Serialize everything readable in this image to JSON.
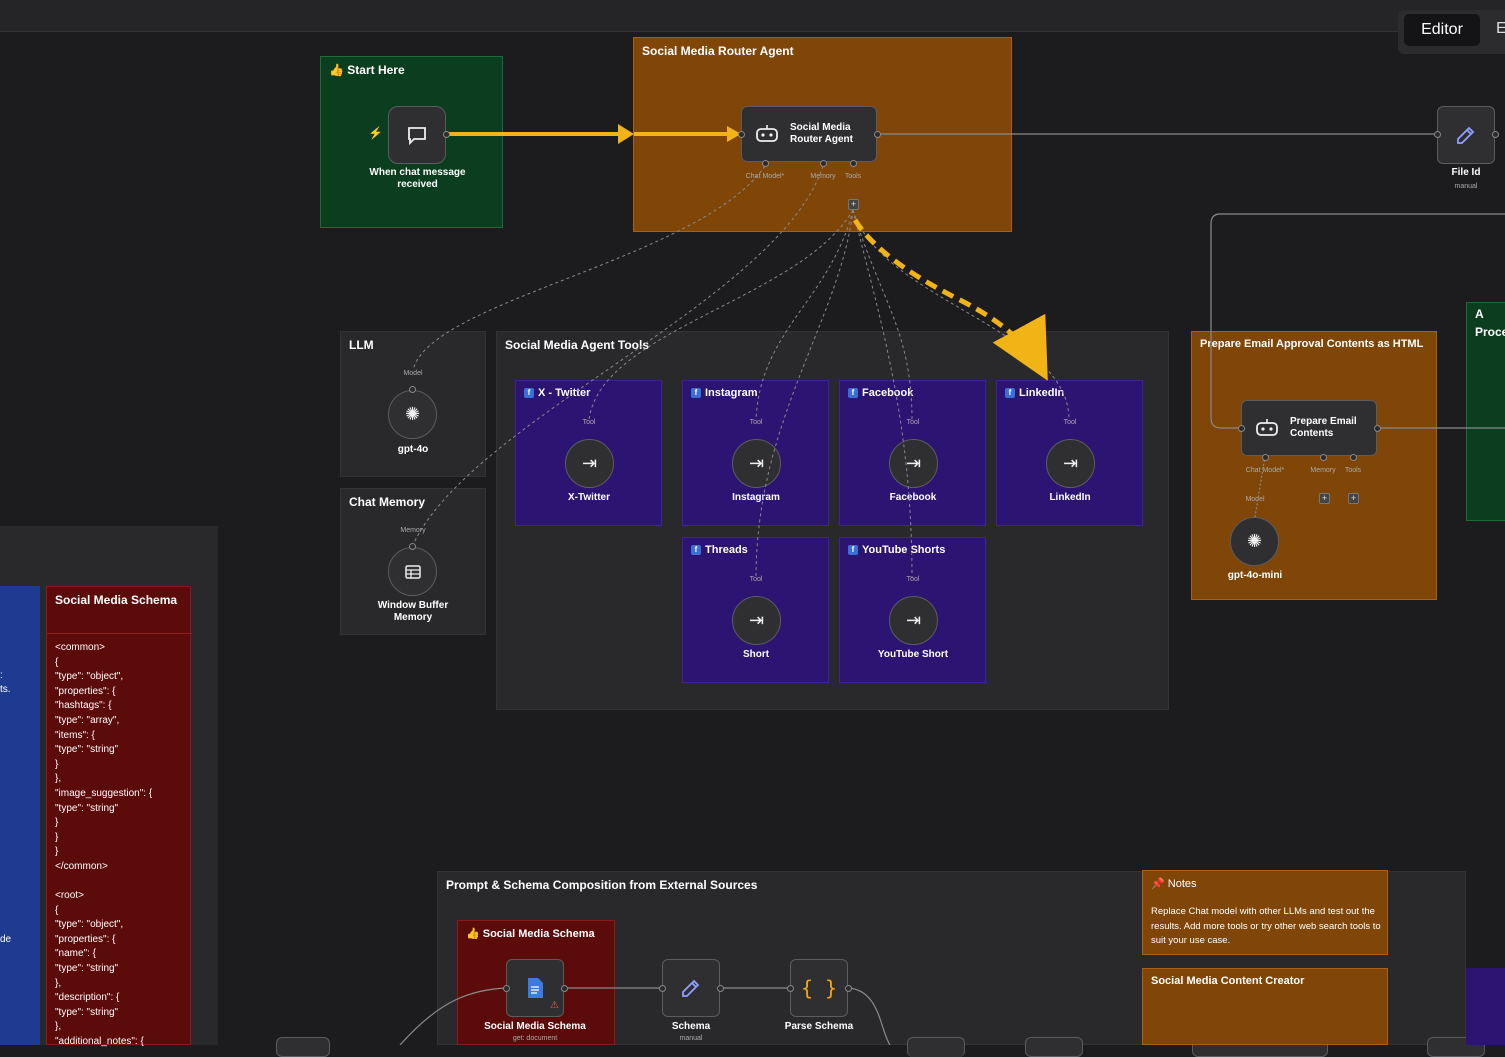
{
  "toolbar": {
    "editor_label": "Editor",
    "executions_label": "E"
  },
  "groups": {
    "start": {
      "title": "👍 Start Here",
      "node_label": "When chat message received"
    },
    "router": {
      "title": "Social Media Router Agent",
      "node_label": "Social Media Router Agent",
      "ports": [
        "Chat Model*",
        "Memory",
        "Tools"
      ]
    },
    "file_id": {
      "label": "File Id",
      "sub": "manual"
    },
    "llm": {
      "title": "LLM",
      "port_label": "Model",
      "node_label": "gpt-4o"
    },
    "chat_memory": {
      "title": "Chat Memory",
      "port_label": "Memory",
      "node_label": "Window Buffer Memory"
    },
    "tools": {
      "title": "Social Media Agent Tools",
      "items": [
        {
          "title": "X - Twitter",
          "port": "Tool",
          "label": "X-Twitter"
        },
        {
          "title": "Instagram",
          "port": "Tool",
          "label": "Instagram"
        },
        {
          "title": "Facebook",
          "port": "Tool",
          "label": "Facebook"
        },
        {
          "title": "LinkedIn",
          "port": "Tool",
          "label": "LinkedIn"
        },
        {
          "title": "Threads",
          "port": "Tool",
          "label": "Short"
        },
        {
          "title": "YouTube Shorts",
          "port": "Tool",
          "label": "YouTube Short"
        }
      ]
    },
    "email": {
      "title": "Prepare Email Approval Contents as HTML",
      "node_label": "Prepare Email Contents",
      "ports": [
        "Chat Model*",
        "Memory",
        "Tools"
      ],
      "model_port": "Model",
      "model_label": "gpt-4o-mini"
    },
    "right_partial": {
      "title_line1": "A",
      "title_line2": "Proce"
    },
    "schema_note": {
      "title": "Social Media Schema",
      "lines": [
        "<common>",
        "{",
        "\"type\": \"object\",",
        "\"properties\": {",
        "\"hashtags\": {",
        "\"type\": \"array\",",
        "\"items\": {",
        "\"type\": \"string\"",
        "}",
        "},",
        "\"image_suggestion\": {",
        "\"type\": \"string\"",
        "}",
        "}",
        "}",
        "</common>",
        "",
        "<root>",
        "{",
        "\"type\": \"object\",",
        "\"properties\": {",
        "\"name\": {",
        "\"type\": \"string\"",
        "},",
        "\"description\": {",
        "\"type\": \"string\"",
        "},",
        "\"additional_notes\": {"
      ]
    },
    "left_partial": {
      "texts": [
        ":",
        "ts.",
        "de"
      ]
    },
    "prompt": {
      "title": "Prompt & Schema Composition from External Sources",
      "schema_group_title": "👍 Social Media Schema",
      "nodes": [
        {
          "label": "Social Media Schema",
          "sub": "get: document"
        },
        {
          "label": "Schema",
          "sub": "manual"
        },
        {
          "label": "Parse Schema",
          "sub": ""
        }
      ]
    },
    "notes": {
      "title": "📌 Notes",
      "body": "Replace Chat model with other LLMs and test out the results. Add more tools or try other web search tools to suit your use case."
    },
    "content_creator": {
      "title": "Social Media Content Creator"
    }
  },
  "colors": {
    "green_group": "#0b3d1f",
    "orange_group": "#7f4608",
    "purple_tool": "#2c1472",
    "dark_red": "#5c0b0b",
    "blue_panel": "#1f3b91",
    "arrow": "#f2b316"
  }
}
